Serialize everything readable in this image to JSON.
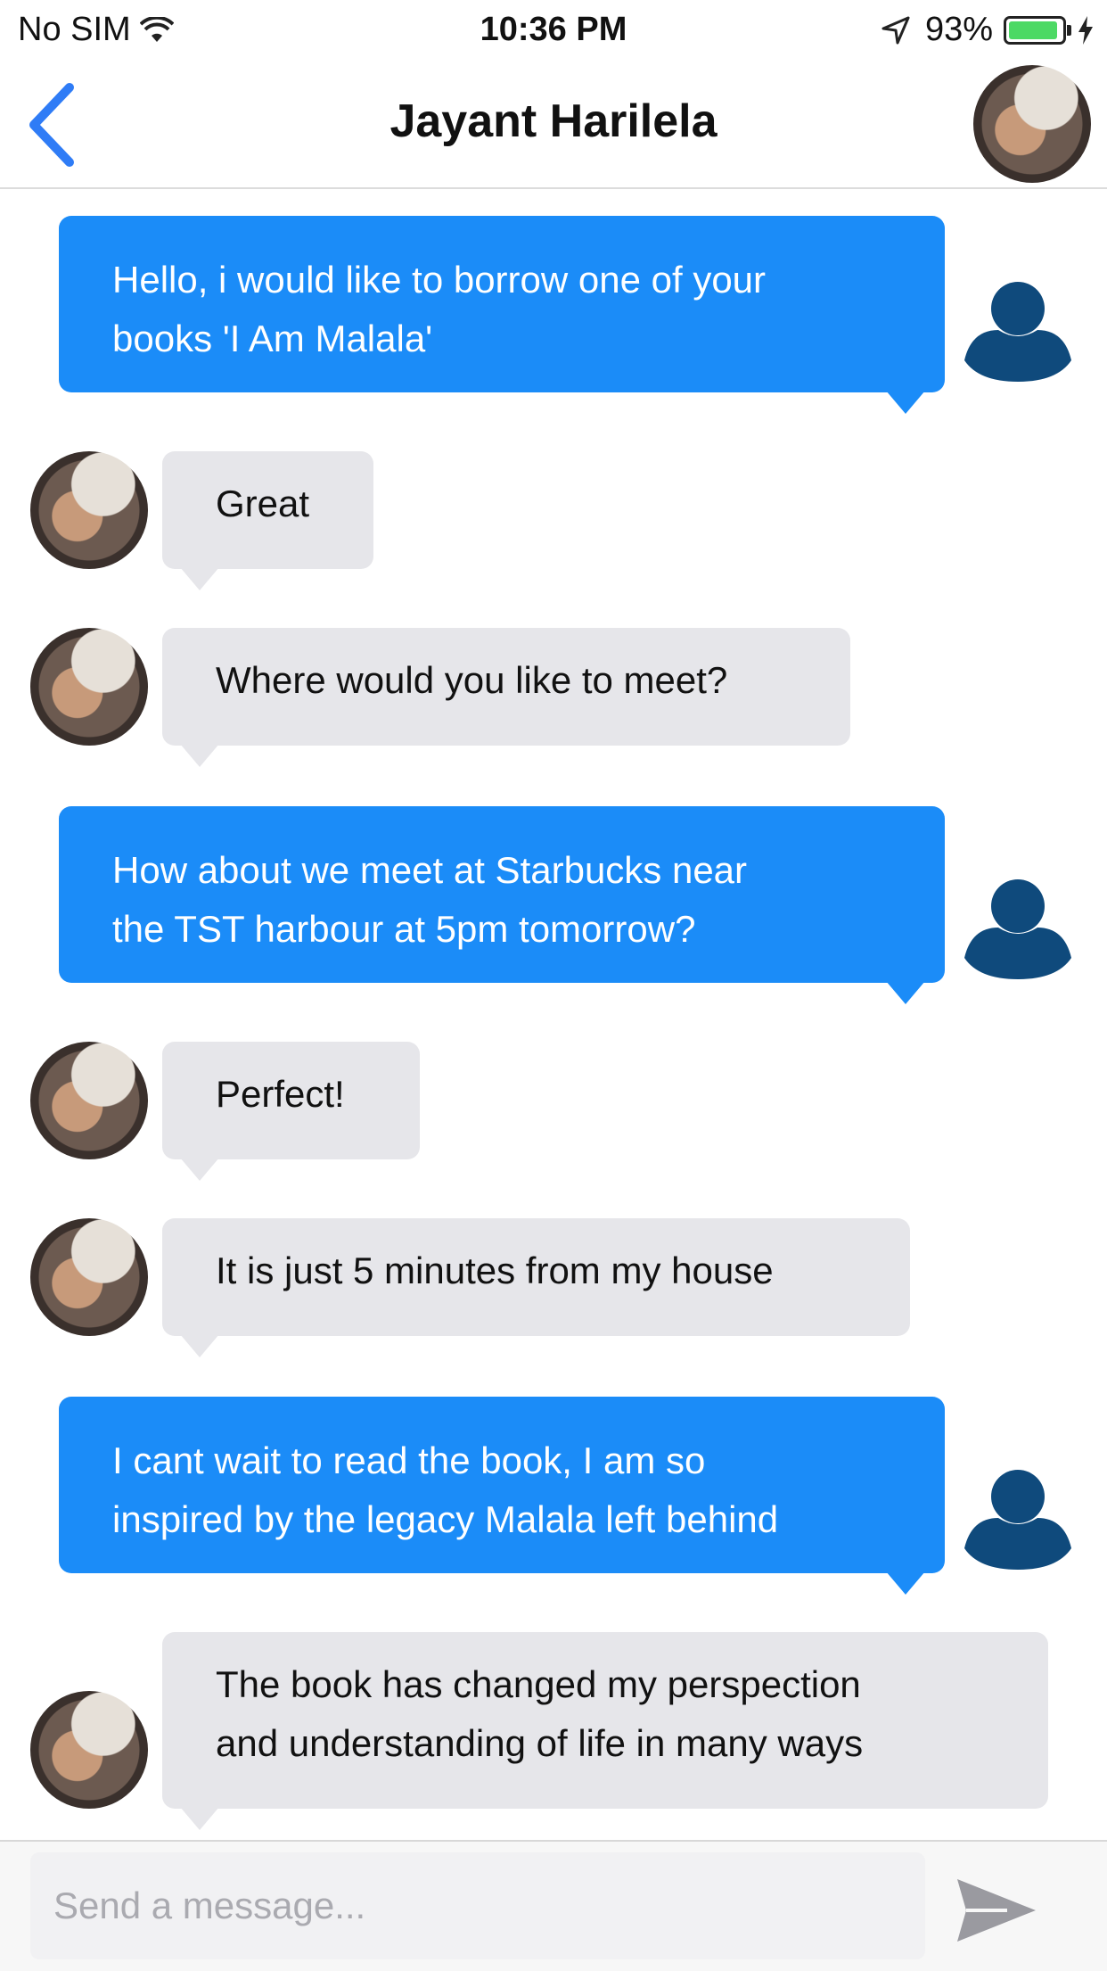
{
  "status_bar": {
    "carrier": "No SIM",
    "time": "10:36 PM",
    "battery_percent": "93%",
    "battery_level": 0.93,
    "battery_color": "#4cd964"
  },
  "nav": {
    "title": "Jayant Harilela",
    "back_icon": "chevron-left-icon"
  },
  "colors": {
    "accent": "#1b8cf8",
    "incoming_bubble": "#e6e6ea",
    "user_icon": "#0f4a7c"
  },
  "messages": [
    {
      "direction": "outgoing",
      "lines": [
        "Hello, i would like to borrow one of your",
        "books 'I Am Malala'"
      ]
    },
    {
      "direction": "incoming",
      "lines": [
        "Great"
      ]
    },
    {
      "direction": "incoming",
      "lines": [
        "Where would you like to meet?"
      ]
    },
    {
      "direction": "outgoing",
      "lines": [
        "How about we meet at Starbucks near",
        "the TST harbour at 5pm tomorrow?"
      ]
    },
    {
      "direction": "incoming",
      "lines": [
        "Perfect!"
      ]
    },
    {
      "direction": "incoming",
      "lines": [
        "It is just 5 minutes from my house"
      ]
    },
    {
      "direction": "outgoing",
      "lines": [
        "I cant wait to read the book, I am so",
        "inspired by the legacy Malala left behind"
      ]
    },
    {
      "direction": "incoming",
      "lines": [
        "The book has changed my perspection",
        "and understanding of life in many ways"
      ]
    }
  ],
  "composer": {
    "placeholder": "Send a message...",
    "value": "",
    "send_icon": "send-icon"
  }
}
